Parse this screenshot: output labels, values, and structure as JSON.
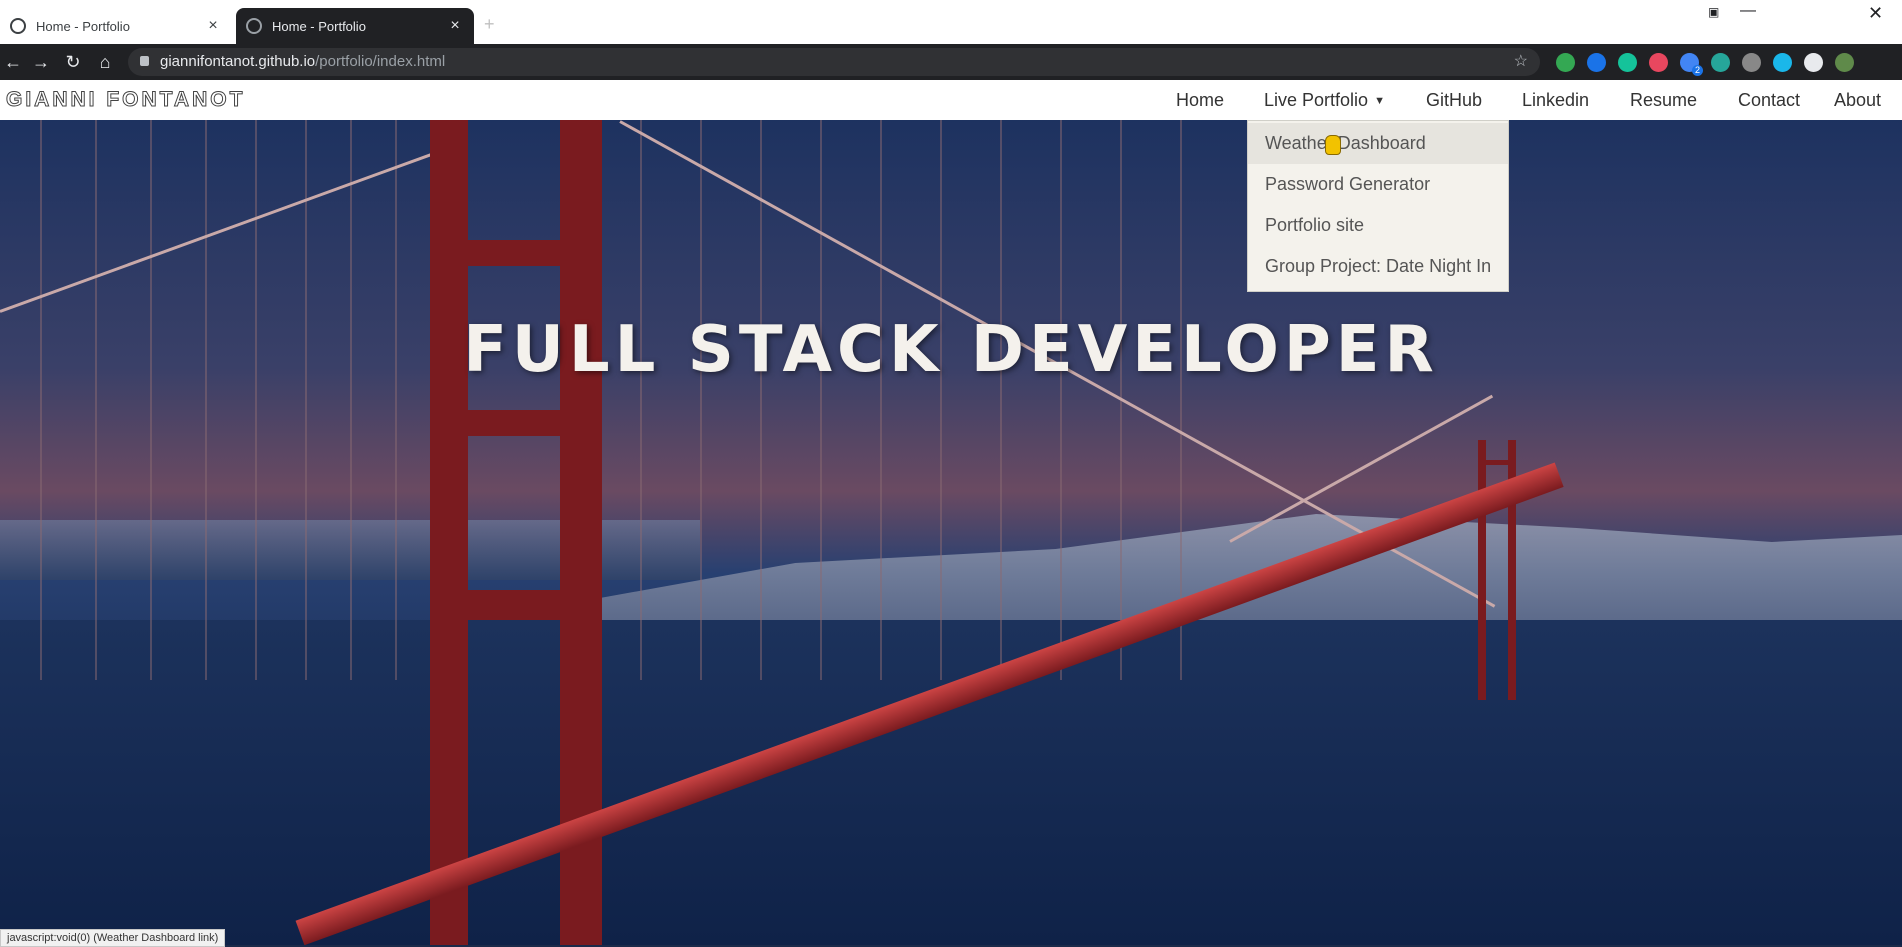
{
  "browser": {
    "tabs": [
      {
        "title": "Home - Portfolio",
        "active": false
      },
      {
        "title": "Home - Portfolio",
        "active": true
      }
    ],
    "new_tab_icon": "plus-icon",
    "address": {
      "host": "giannifontanot.github.io",
      "path": "/portfolio/index.html"
    },
    "extensions": [
      {
        "name": "sheets-extension-icon",
        "color": "#34a853"
      },
      {
        "name": "maps-extension-icon",
        "color": "#1a73e8"
      },
      {
        "name": "grammar-extension-icon",
        "color": "#15c39a"
      },
      {
        "name": "palette-extension-icon",
        "color": "#e8475f"
      },
      {
        "name": "badge-extension-icon",
        "color": "#4285f4",
        "badge": "2"
      },
      {
        "name": "record-extension-icon",
        "color": "#26a69a"
      },
      {
        "name": "link-extension-icon",
        "color": "#888888"
      },
      {
        "name": "vimeo-extension-icon",
        "color": "#1ab7ea"
      },
      {
        "name": "puzzle-extensions-icon",
        "color": "#e8eaed"
      },
      {
        "name": "profile-avatar-icon",
        "color": "#5f8a4a"
      }
    ]
  },
  "site": {
    "brand": "GIANNI FONTANOT",
    "nav": [
      {
        "label": "Home"
      },
      {
        "label": "Live Portfolio",
        "dropdown": true
      },
      {
        "label": "GitHub"
      },
      {
        "label": "Linkedin"
      },
      {
        "label": "Resume"
      },
      {
        "label": "Contact"
      },
      {
        "label": "About"
      }
    ],
    "dropdown_items": [
      {
        "label": "Weather Dashboard",
        "hovered": true
      },
      {
        "label": "Password Generator"
      },
      {
        "label": "Portfolio site"
      },
      {
        "label": "Group Project: Date Night In"
      }
    ],
    "hero_title": "FULL STACK DEVELOPER"
  },
  "status_bar": "javascript:void(0) (Weather Dashboard link)"
}
